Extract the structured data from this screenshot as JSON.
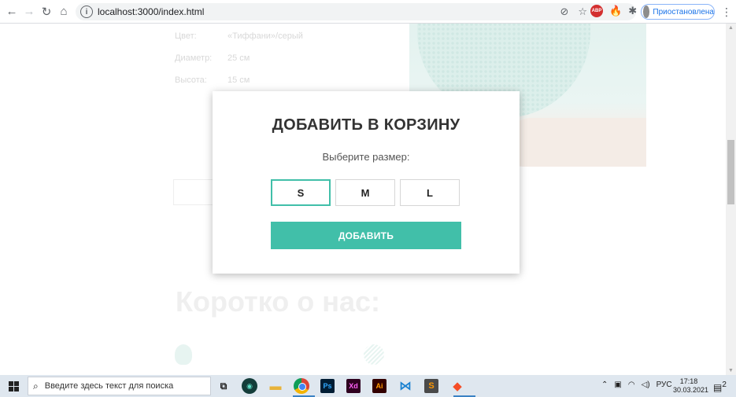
{
  "browser": {
    "url": "localhost:3000/index.html",
    "profile_status": "Приостановлена",
    "icons": [
      "back-arrow-icon",
      "forward-arrow-icon",
      "reload-icon",
      "home-icon",
      "site-info-icon",
      "tracking-off-icon",
      "star-icon",
      "adblock-icon",
      "flame-icon",
      "extensions-icon",
      "menu-dots-icon"
    ],
    "abp_label": "ABP"
  },
  "page": {
    "props": [
      {
        "k": "Цвет:",
        "v": "«Тиффани»/серый"
      },
      {
        "k": "Диаметр:",
        "v": "25 см"
      },
      {
        "k": "Высота:",
        "v": "15 см"
      }
    ],
    "section_title": "Коротко о нас:"
  },
  "modal": {
    "title": "ДОБАВИТЬ В КОРЗИНУ",
    "subtitle": "Выберите размер:",
    "sizes": [
      "S",
      "M",
      "L"
    ],
    "selected_size": "S",
    "add_label": "ДОБАВИТЬ",
    "accent": "#41bfa9"
  },
  "taskbar": {
    "search_placeholder": "Введите здесь текст для поиска",
    "apps": [
      "task-view",
      "extension-app",
      "file-explorer",
      "chrome",
      "photoshop",
      "xd",
      "illustrator",
      "vscode",
      "sublime-text",
      "git-kraken"
    ],
    "app_labels": {
      "ps": "Ps",
      "xd": "Xd",
      "ai": "Ai",
      "sublime": "S"
    },
    "lang": "РУС",
    "time": "17:18",
    "date": "30.03.2021",
    "notif_count": "2"
  }
}
